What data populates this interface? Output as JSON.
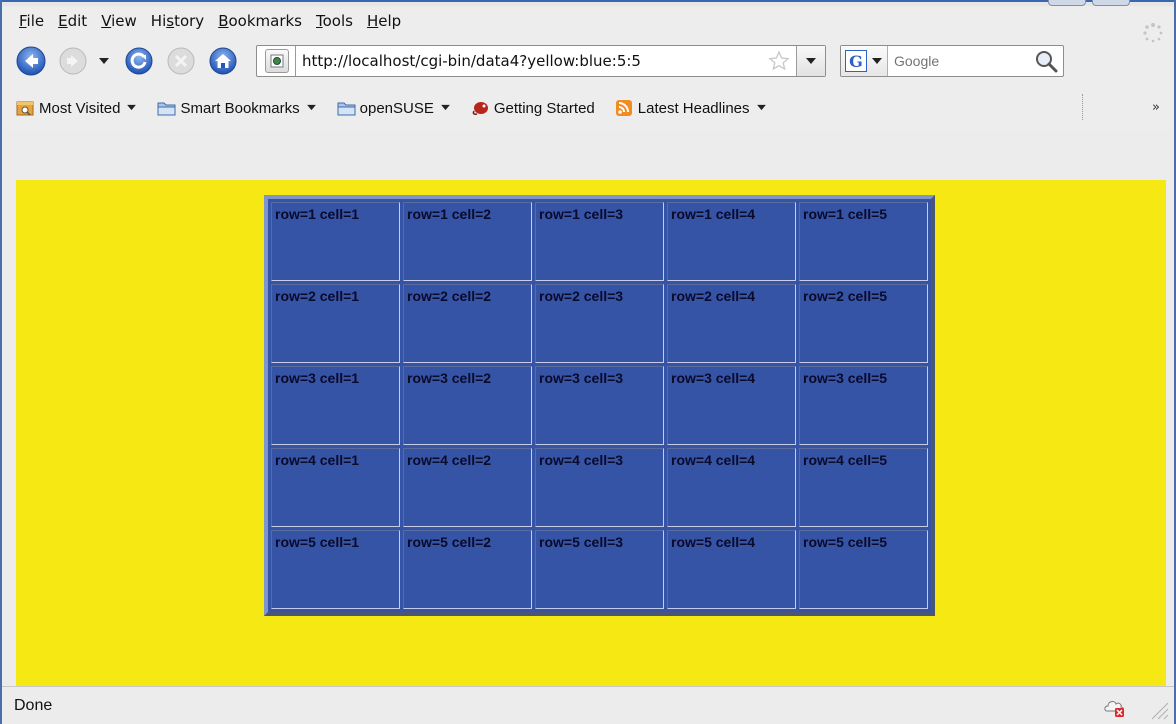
{
  "menubar": {
    "items": [
      {
        "prefix": "",
        "accel": "F",
        "suffix": "ile"
      },
      {
        "prefix": "",
        "accel": "E",
        "suffix": "dit"
      },
      {
        "prefix": "",
        "accel": "V",
        "suffix": "iew"
      },
      {
        "prefix": "Hi",
        "accel": "s",
        "suffix": "tory"
      },
      {
        "prefix": "",
        "accel": "B",
        "suffix": "ookmarks"
      },
      {
        "prefix": "",
        "accel": "T",
        "suffix": "ools"
      },
      {
        "prefix": "",
        "accel": "H",
        "suffix": "elp"
      }
    ]
  },
  "navbar": {
    "url": "http://localhost/cgi-bin/data4?yellow:blue:5:5",
    "search_placeholder": "Google",
    "search_engine_letter": "G"
  },
  "bookmarks": {
    "items": [
      {
        "label": "Most Visited",
        "icon": "most-visited-icon",
        "has_caret": true
      },
      {
        "label": "Smart Bookmarks",
        "icon": "folder-icon",
        "has_caret": true
      },
      {
        "label": "openSUSE",
        "icon": "folder-icon",
        "has_caret": true
      },
      {
        "label": "Getting Started",
        "icon": "chameleon-icon",
        "has_caret": false
      },
      {
        "label": "Latest Headlines",
        "icon": "rss-icon",
        "has_caret": true
      }
    ],
    "overflow": "»"
  },
  "content": {
    "background_color": "#f5e813",
    "table_color": "#3654a6",
    "rows": [
      [
        "row=1 cell=1",
        "row=1 cell=2",
        "row=1 cell=3",
        "row=1 cell=4",
        "row=1 cell=5"
      ],
      [
        "row=2 cell=1",
        "row=2 cell=2",
        "row=2 cell=3",
        "row=2 cell=4",
        "row=2 cell=5"
      ],
      [
        "row=3 cell=1",
        "row=3 cell=2",
        "row=3 cell=3",
        "row=3 cell=4",
        "row=3 cell=5"
      ],
      [
        "row=4 cell=1",
        "row=4 cell=2",
        "row=4 cell=3",
        "row=4 cell=4",
        "row=4 cell=5"
      ],
      [
        "row=5 cell=1",
        "row=5 cell=2",
        "row=5 cell=3",
        "row=5 cell=4",
        "row=5 cell=5"
      ]
    ]
  },
  "statusbar": {
    "text": "Done"
  }
}
